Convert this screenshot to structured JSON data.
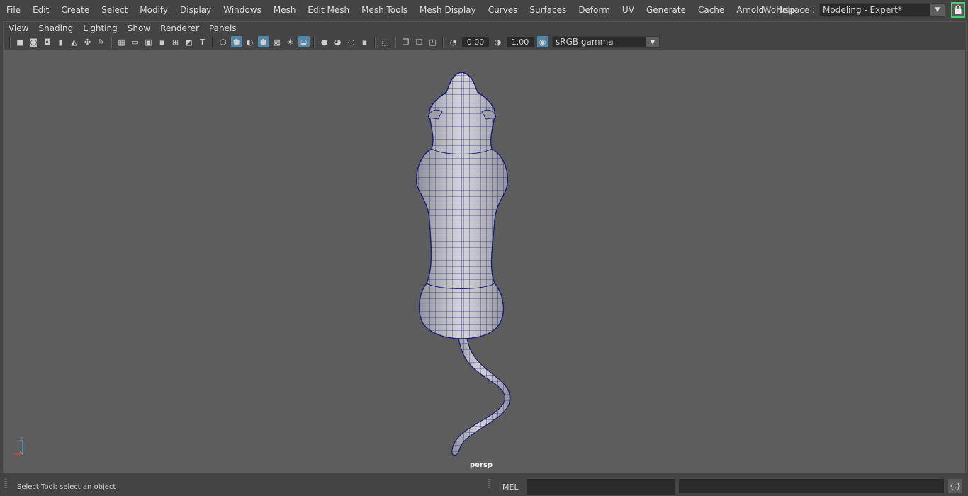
{
  "main_menu": {
    "items": [
      "File",
      "Edit",
      "Create",
      "Select",
      "Modify",
      "Display",
      "Windows",
      "Mesh",
      "Edit Mesh",
      "Mesh Tools",
      "Mesh Display",
      "Curves",
      "Surfaces",
      "Deform",
      "UV",
      "Generate",
      "Cache",
      "Arnold",
      "Help"
    ]
  },
  "workspace": {
    "label": "Workspace :",
    "value": "Modeling - Expert*"
  },
  "panel_menu": {
    "items": [
      "View",
      "Shading",
      "Lighting",
      "Show",
      "Renderer",
      "Panels"
    ]
  },
  "toolbar": {
    "exposure_value": "0.00",
    "gamma_value": "1.00",
    "color_space": "sRGB gamma"
  },
  "viewport": {
    "camera_name": "persp",
    "axis_z_label": "z"
  },
  "status": {
    "help_line": "Select Tool: select an object",
    "command_language": "MEL"
  },
  "colors": {
    "accent_blue": "#5285a6",
    "wireframe": "#1a1e7a",
    "viewport_bg": "#5d5d5d",
    "lock_outline": "#56c870"
  }
}
